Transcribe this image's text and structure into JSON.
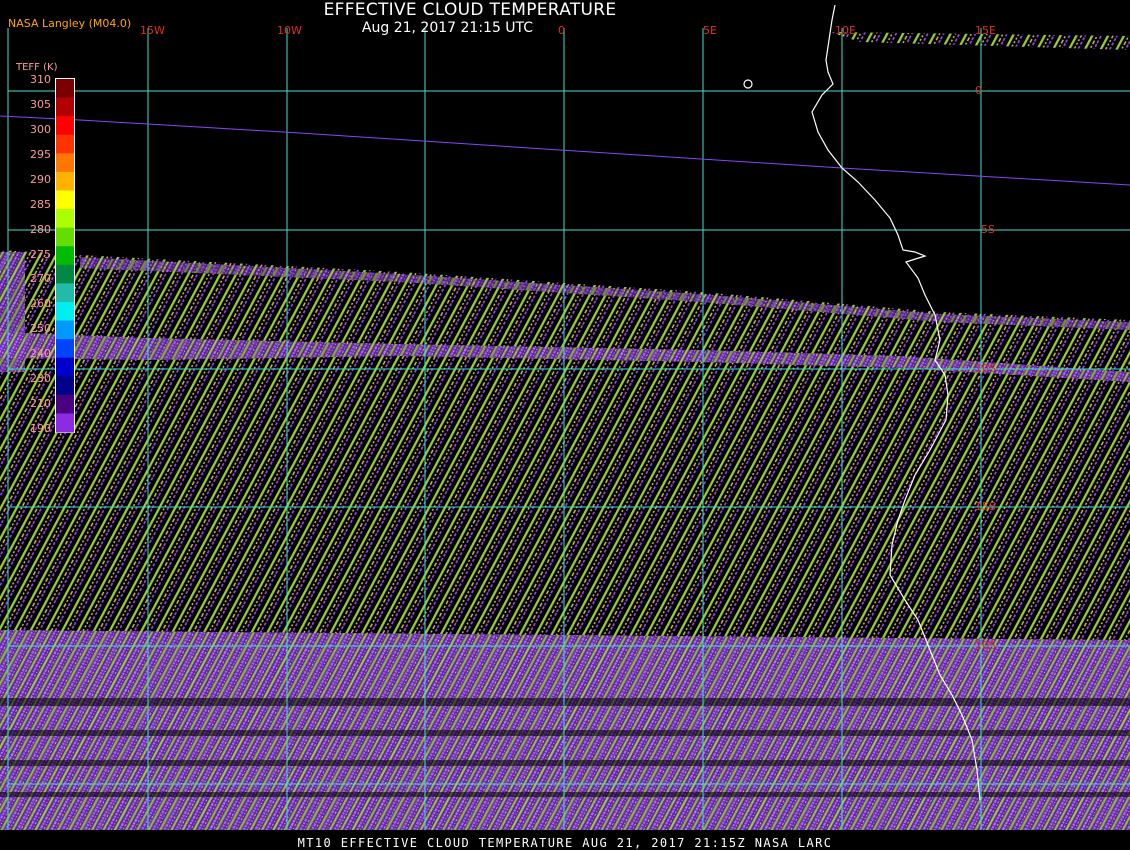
{
  "header": {
    "title": "EFFECTIVE CLOUD TEMPERATURE",
    "subtitle": "Aug 21, 2017 21:15 UTC",
    "source": "NASA Langley (M04.0)"
  },
  "footer": {
    "text": "MT10  EFFECTIVE CLOUD TEMPERATURE   AUG 21, 2017 21:15Z   NASA LARC"
  },
  "legend": {
    "title": "TEFF (K)",
    "labels": [
      "310",
      "305",
      "300",
      "295",
      "290",
      "285",
      "280",
      "275",
      "270",
      "260",
      "250",
      "240",
      "230",
      "210",
      "190"
    ],
    "colors": [
      "#7a0000",
      "#b20000",
      "#ff0000",
      "#ff3300",
      "#ff7700",
      "#ffb300",
      "#ffff00",
      "#aaff00",
      "#66dd00",
      "#00bb00",
      "#008844",
      "#22bbaa",
      "#00eeee",
      "#0099ff",
      "#0044ff",
      "#0000cc",
      "#00008b",
      "#4b0082",
      "#8b2be2"
    ]
  },
  "grid": {
    "lon_labels": [
      "15W",
      "10W",
      "0",
      "5E",
      "10E",
      "15E"
    ],
    "lat_labels": [
      "0",
      "5S",
      "10S",
      "15S",
      "20S"
    ],
    "colors": {
      "grid": "#40e0d0",
      "labels": "#e0301f",
      "coast": "#ffffff",
      "terminator": "#8844ff"
    }
  }
}
